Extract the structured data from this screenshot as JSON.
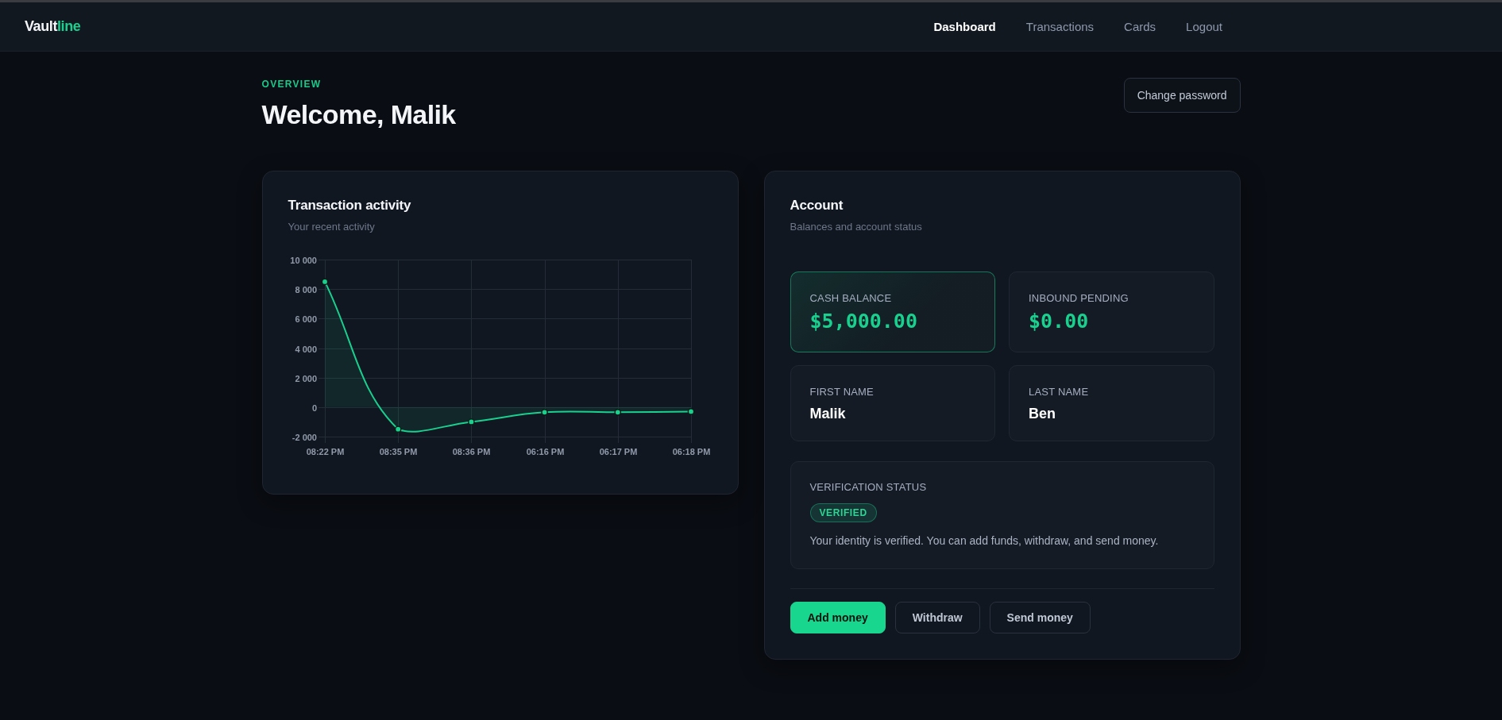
{
  "nav": {
    "logo": {
      "lead": "Vault",
      "accent": "line"
    },
    "links": [
      {
        "label": "Dashboard",
        "selected": true
      },
      {
        "label": "Transactions",
        "selected": false
      },
      {
        "label": "Cards",
        "selected": false
      },
      {
        "label": "Logout",
        "selected": false
      }
    ]
  },
  "page_header": {
    "eyebrow": "OVERVIEW",
    "title": "Welcome, Malik",
    "button": "Change password"
  },
  "activity_card": {
    "title": "Transaction activity",
    "subtitle": "Your recent activity",
    "chart_data": {
      "type": "area",
      "grid": true,
      "categories": [
        "08:22 PM",
        "08:35 PM",
        "08:36 PM",
        "06:16 PM",
        "06:17 PM",
        "06:18 PM"
      ],
      "values": [
        8500,
        -1500,
        -1000,
        -350,
        -350,
        -300
      ],
      "ylim": [
        -2000,
        10000
      ],
      "yticks": [
        {
          "value": -2000,
          "label": "-2 000"
        },
        {
          "value": 0,
          "label": "0"
        },
        {
          "value": 2000,
          "label": "2 000"
        },
        {
          "value": 4000,
          "label": "4 000"
        },
        {
          "value": 6000,
          "label": "6 000"
        },
        {
          "value": 8000,
          "label": "8 000"
        },
        {
          "value": 10000,
          "label": "10 000"
        }
      ]
    }
  },
  "account_card": {
    "title": "Account",
    "subtitle": "Balances and account status",
    "tiles": [
      {
        "label": "CASH BALANCE",
        "value": "$5,000.00",
        "kind": "money",
        "highlighted": true
      },
      {
        "label": "INBOUND PENDING",
        "value": "$0.00",
        "kind": "money",
        "highlighted": false
      },
      {
        "label": "FIRST NAME",
        "value": "Malik",
        "kind": "text",
        "highlighted": false
      },
      {
        "label": "LAST NAME",
        "value": "Ben",
        "kind": "text",
        "highlighted": false
      }
    ],
    "verification": {
      "label": "VERIFICATION STATUS",
      "badge": "VERIFIED",
      "verified": true,
      "message": "Your identity is verified. You can add funds, withdraw, and send money."
    },
    "buttons": [
      {
        "label": "Add money",
        "kind": "primary"
      },
      {
        "label": "Withdraw",
        "kind": "secondary"
      },
      {
        "label": "Send money",
        "kind": "secondary"
      }
    ]
  }
}
